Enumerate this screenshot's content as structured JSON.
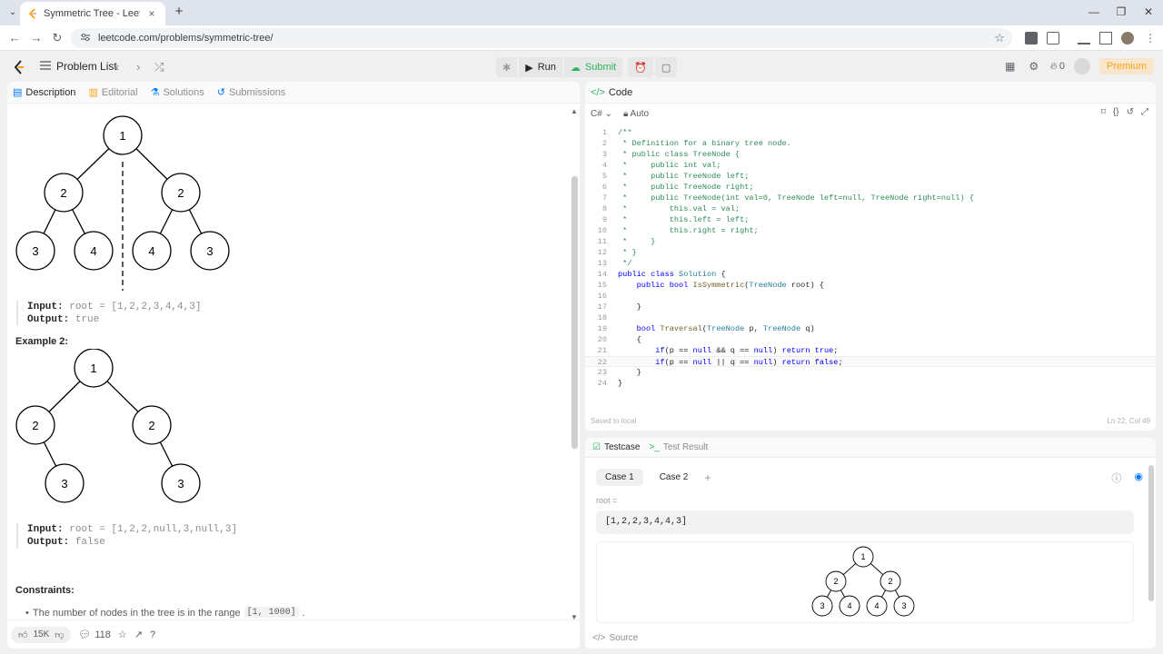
{
  "browser": {
    "tab_title": "Symmetric Tree - LeetCode",
    "url": "leetcode.com/problems/symmetric-tree/",
    "new_tab_symbol": "+",
    "close_symbol": "×"
  },
  "nav": {
    "problem_list_label": "Problem List",
    "run_label": "Run",
    "submit_label": "Submit",
    "streak_count": "0",
    "premium_label": "Premium"
  },
  "left_tabs": [
    {
      "label": "Description"
    },
    {
      "label": "Editorial"
    },
    {
      "label": "Solutions"
    },
    {
      "label": "Submissions"
    }
  ],
  "example1": {
    "tree_nodes": [
      "1",
      "2",
      "2",
      "3",
      "4",
      "4",
      "3"
    ],
    "input_key": "Input:",
    "input_value": "root = [1,2,2,3,4,4,3]",
    "output_key": "Output:",
    "output_value": "true"
  },
  "example2": {
    "title": "Example 2:",
    "tree_nodes": [
      "1",
      "2",
      "2",
      "3",
      "3"
    ],
    "input_key": "Input:",
    "input_value": "root = [1,2,2,null,3,null,3]",
    "output_key": "Output:",
    "output_value": "false"
  },
  "constraints": {
    "title": "Constraints:",
    "item_text": "The number of nodes in the tree is in the range",
    "item_range": "[1, 1000]",
    "item_end": "."
  },
  "bottom_bar": {
    "likes": "15K",
    "comments": "118"
  },
  "code_panel": {
    "tab_label": "Code",
    "language": "C#",
    "mode": "Auto",
    "status": "Saved to local",
    "cursor": "Ln 22, Col 49",
    "lines": [
      {
        "n": "1",
        "tokens": [
          {
            "t": "/**",
            "c": "comment"
          }
        ]
      },
      {
        "n": "2",
        "tokens": [
          {
            "t": " * Definition for a binary tree node.",
            "c": "comment"
          }
        ]
      },
      {
        "n": "3",
        "tokens": [
          {
            "t": " * public class TreeNode {",
            "c": "comment"
          }
        ]
      },
      {
        "n": "4",
        "tokens": [
          {
            "t": " *     public int val;",
            "c": "comment"
          }
        ]
      },
      {
        "n": "5",
        "tokens": [
          {
            "t": " *     public TreeNode left;",
            "c": "comment"
          }
        ]
      },
      {
        "n": "6",
        "tokens": [
          {
            "t": " *     public TreeNode right;",
            "c": "comment"
          }
        ]
      },
      {
        "n": "7",
        "tokens": [
          {
            "t": " *     public TreeNode(int val=0, TreeNode left=null, TreeNode right=null) {",
            "c": "comment"
          }
        ]
      },
      {
        "n": "8",
        "tokens": [
          {
            "t": " *         this.val = val;",
            "c": "comment"
          }
        ]
      },
      {
        "n": "9",
        "tokens": [
          {
            "t": " *         this.left = left;",
            "c": "comment"
          }
        ]
      },
      {
        "n": "10",
        "tokens": [
          {
            "t": " *         this.right = right;",
            "c": "comment"
          }
        ]
      },
      {
        "n": "11",
        "tokens": [
          {
            "t": " *     }",
            "c": "comment"
          }
        ]
      },
      {
        "n": "12",
        "tokens": [
          {
            "t": " * }",
            "c": "comment"
          }
        ]
      },
      {
        "n": "13",
        "tokens": [
          {
            "t": " */",
            "c": "comment"
          }
        ]
      },
      {
        "n": "14",
        "tokens": [
          {
            "t": "public class ",
            "c": "kw"
          },
          {
            "t": "Solution",
            "c": "type"
          },
          {
            "t": " {",
            "c": "plain"
          }
        ]
      },
      {
        "n": "15",
        "tokens": [
          {
            "t": "    public bool ",
            "c": "kw"
          },
          {
            "t": "IsSymmetric",
            "c": "fn"
          },
          {
            "t": "(",
            "c": "plain"
          },
          {
            "t": "TreeNode",
            "c": "type"
          },
          {
            "t": " root) {",
            "c": "plain"
          }
        ]
      },
      {
        "n": "16",
        "tokens": [
          {
            "t": "",
            "c": "plain"
          }
        ]
      },
      {
        "n": "17",
        "tokens": [
          {
            "t": "    }",
            "c": "plain"
          }
        ]
      },
      {
        "n": "18",
        "tokens": [
          {
            "t": "",
            "c": "plain"
          }
        ]
      },
      {
        "n": "19",
        "tokens": [
          {
            "t": "    bool ",
            "c": "kw"
          },
          {
            "t": "Traversal",
            "c": "fn"
          },
          {
            "t": "(",
            "c": "plain"
          },
          {
            "t": "TreeNode",
            "c": "type"
          },
          {
            "t": " p, ",
            "c": "plain"
          },
          {
            "t": "TreeNode",
            "c": "type"
          },
          {
            "t": " q)",
            "c": "plain"
          }
        ]
      },
      {
        "n": "20",
        "tokens": [
          {
            "t": "    {",
            "c": "plain"
          }
        ]
      },
      {
        "n": "21",
        "tokens": [
          {
            "t": "        if",
            "c": "kw"
          },
          {
            "t": "(p == ",
            "c": "plain"
          },
          {
            "t": "null",
            "c": "kw"
          },
          {
            "t": " && q == ",
            "c": "plain"
          },
          {
            "t": "null",
            "c": "kw"
          },
          {
            "t": ") ",
            "c": "plain"
          },
          {
            "t": "return true",
            "c": "kw"
          },
          {
            "t": ";",
            "c": "plain"
          }
        ]
      },
      {
        "n": "22",
        "tokens": [
          {
            "t": "        if",
            "c": "kw"
          },
          {
            "t": "(p == ",
            "c": "plain"
          },
          {
            "t": "null",
            "c": "kw"
          },
          {
            "t": " || q == ",
            "c": "plain"
          },
          {
            "t": "null",
            "c": "kw"
          },
          {
            "t": ") ",
            "c": "plain"
          },
          {
            "t": "return false",
            "c": "kw"
          },
          {
            "t": ";",
            "c": "plain"
          }
        ]
      },
      {
        "n": "23",
        "tokens": [
          {
            "t": "    }",
            "c": "plain"
          }
        ]
      },
      {
        "n": "24",
        "tokens": [
          {
            "t": "}",
            "c": "plain"
          }
        ]
      }
    ]
  },
  "test_panel": {
    "tab_testcase": "Testcase",
    "tab_result": "Test Result",
    "cases": [
      {
        "label": "Case 1"
      },
      {
        "label": "Case 2"
      }
    ],
    "add_case": "+",
    "param_label": "root =",
    "param_value": "[1,2,2,3,4,4,3]",
    "tree_nodes": [
      "1",
      "2",
      "2",
      "3",
      "4",
      "4",
      "3"
    ],
    "source_label": "Source"
  },
  "colors": {
    "accent": "#ffa116",
    "submit_green": "#2db55d",
    "description_blue": "#007aff"
  }
}
